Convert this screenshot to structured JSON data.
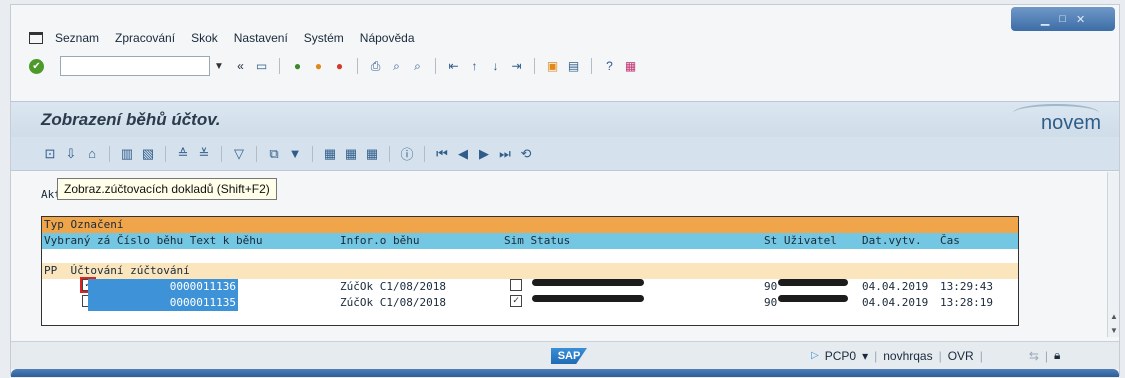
{
  "menubar": {
    "items": [
      "Seznam",
      "Zpracování",
      "Skok",
      "Nastavení",
      "Systém",
      "Nápověda"
    ]
  },
  "system_toolbar": {
    "command_value": "",
    "icons": [
      "enter-icon",
      "save-icon",
      "back-icon",
      "exit-icon",
      "cancel-icon",
      "print-icon",
      "find-icon",
      "find-next-icon",
      "first-page-icon",
      "prev-page-icon",
      "next-page-icon",
      "last-page-icon",
      "new-session-icon",
      "shortcut-icon",
      "help-icon",
      "layout-icon"
    ]
  },
  "title": {
    "text": "Zobrazení běhů účtov.",
    "logo": "novem"
  },
  "tooltip": {
    "prefix": "Akt",
    "text": "Zobraz.zúčtovacích dokladů  (Shift+F2)"
  },
  "list": {
    "header1": "Typ Označení",
    "header2": {
      "col1": "Vybraný zá Číslo běhu Text k běhu",
      "col2": "Infor.o běhu",
      "col3": "Sim Status",
      "col4": "St Uživatel",
      "col5": "Dat.vytv.",
      "col6": "Čas"
    },
    "group": "PP  Účtování zúčtování",
    "rows": [
      {
        "checked": true,
        "number": "0000011136",
        "info": "ZúčOk C1/08/2018",
        "sim_checked": false,
        "st": "90",
        "date": "04.04.2019",
        "time": "13:29:43"
      },
      {
        "checked": false,
        "number": "0000011135",
        "info": "ZúčOk C1/08/2018",
        "sim_checked": true,
        "st": "90",
        "date": "04.04.2019",
        "time": "13:28:19"
      }
    ]
  },
  "statusbar": {
    "sap": "SAP",
    "system": "PCP0",
    "user": "novhrqas",
    "mode": "OVR"
  }
}
